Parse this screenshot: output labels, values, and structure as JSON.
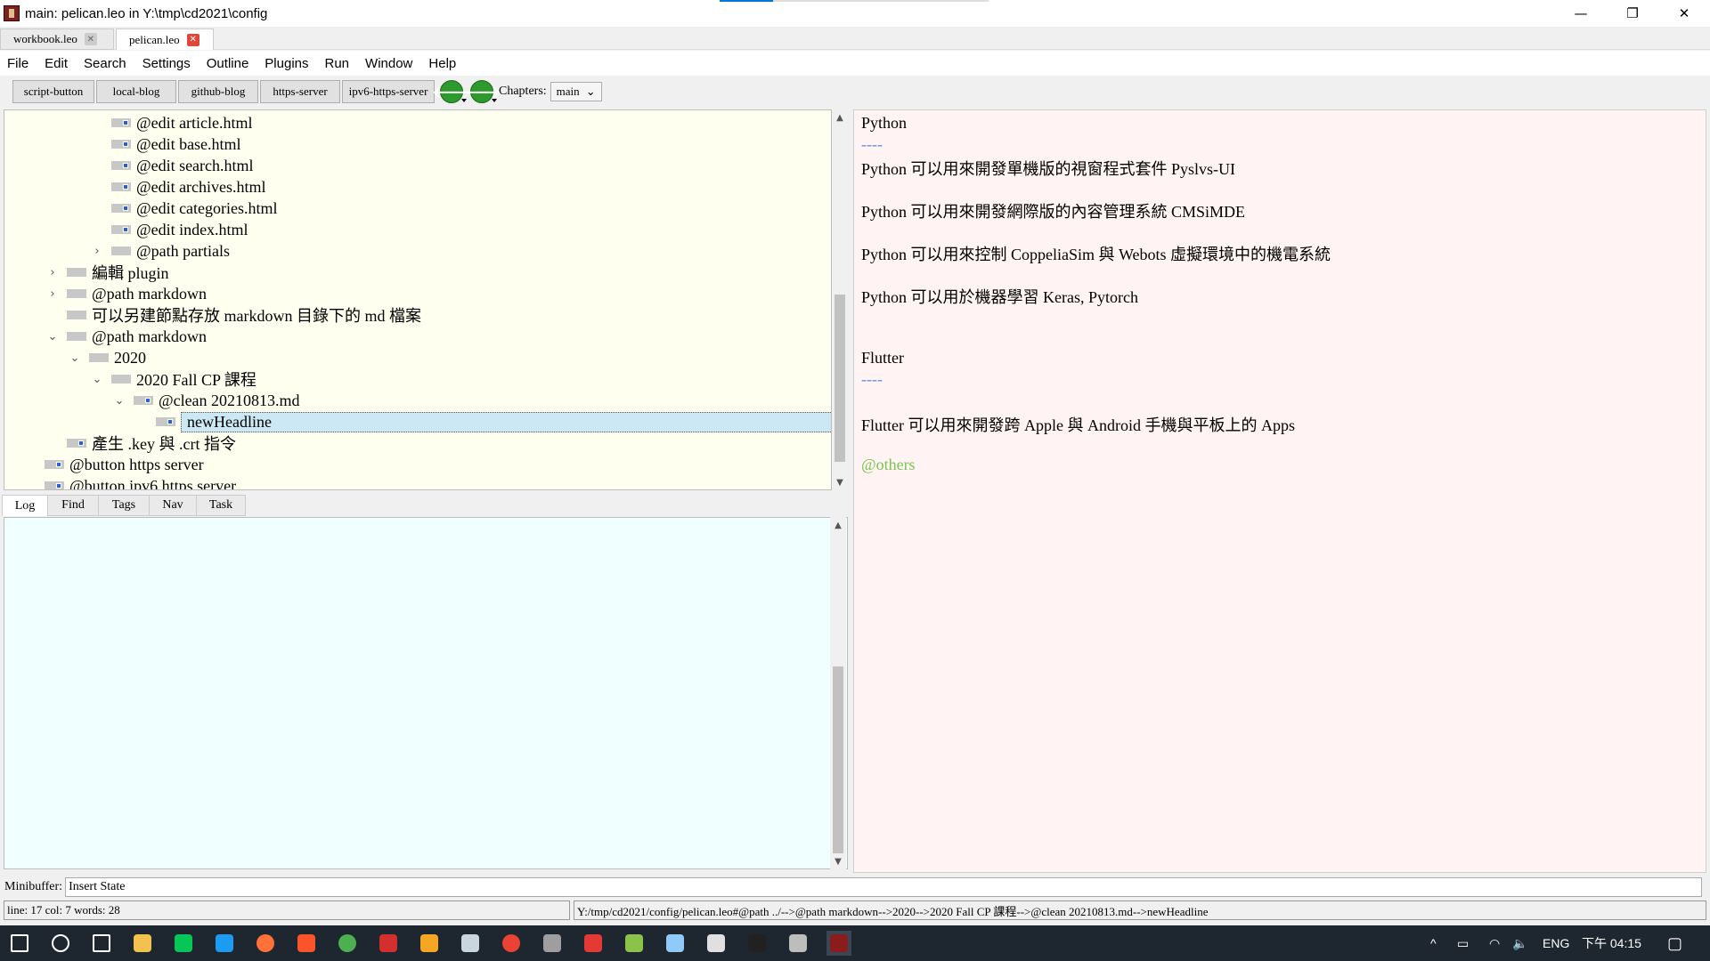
{
  "window": {
    "title": "main: pelican.leo in Y:\\tmp\\cd2021\\config",
    "controls": {
      "minimize": "—",
      "maximize": "❐",
      "close": "✕"
    },
    "progress_fraction": 0.2
  },
  "file_tabs": [
    {
      "label": "workbook.leo",
      "active": false
    },
    {
      "label": "pelican.leo",
      "active": true
    }
  ],
  "menu": [
    "File",
    "Edit",
    "Search",
    "Settings",
    "Outline",
    "Plugins",
    "Run",
    "Window",
    "Help"
  ],
  "toolbar": {
    "buttons": [
      "script-button",
      "local-blog",
      "github-blog",
      "https-server",
      "ipv6-https-server"
    ],
    "back_glyph": "🡐",
    "forward_glyph": "🡒",
    "chapters_label": "Chapters:",
    "chapters_value": "main"
  },
  "outline": {
    "rows": [
      {
        "text": "@edit article.html",
        "level": 4,
        "chevron": "",
        "icon": "dirty"
      },
      {
        "text": "@edit base.html",
        "level": 4,
        "chevron": "",
        "icon": "dirty"
      },
      {
        "text": "@edit search.html",
        "level": 4,
        "chevron": "",
        "icon": "dirty"
      },
      {
        "text": "@edit archives.html",
        "level": 4,
        "chevron": "",
        "icon": "dirty"
      },
      {
        "text": "@edit categories.html",
        "level": 4,
        "chevron": "",
        "icon": "dirty"
      },
      {
        "text": "@edit index.html",
        "level": 4,
        "chevron": "",
        "icon": "dirty"
      },
      {
        "text": "@path partials",
        "level": 4,
        "chevron": "›",
        "icon": "plain"
      },
      {
        "text": "編輯 plugin",
        "level": 2,
        "chevron": "›",
        "icon": "plain"
      },
      {
        "text": "@path markdown",
        "level": 2,
        "chevron": "›",
        "icon": "plain"
      },
      {
        "text": "可以另建節點存放 markdown 目錄下的 md 檔案",
        "level": 2,
        "chevron": "",
        "icon": "plain"
      },
      {
        "text": "@path markdown",
        "level": 2,
        "chevron": "⌄",
        "icon": "plain"
      },
      {
        "text": "2020",
        "level": 3,
        "chevron": "⌄",
        "icon": "plain"
      },
      {
        "text": "2020 Fall CP 課程",
        "level": 4,
        "chevron": "⌄",
        "icon": "plain"
      },
      {
        "text": "@clean 20210813.md",
        "level": 5,
        "chevron": "⌄",
        "icon": "dirty"
      },
      {
        "text": "newHeadline",
        "level": 6,
        "chevron": "",
        "icon": "dirty",
        "selected": true
      },
      {
        "text": "產生 .key 與 .crt 指令",
        "level": 2,
        "chevron": "",
        "icon": "dirty"
      },
      {
        "text": "@button https server",
        "level": 1,
        "chevron": "",
        "icon": "dirty"
      },
      {
        "text": "@button ipv6 https server",
        "level": 1,
        "chevron": "",
        "icon": "dirty"
      }
    ]
  },
  "bottom_tabs": [
    "Log",
    "Find",
    "Tags",
    "Nav",
    "Task"
  ],
  "body_lines": [
    {
      "text": "Python",
      "style": "normal"
    },
    {
      "text": "----",
      "style": "dash"
    },
    {
      "text": "Python 可以用來開發單機版的視窗程式套件 Pyslvs-UI",
      "style": "normal"
    },
    {
      "text": "",
      "style": "normal"
    },
    {
      "text": "Python 可以用來開發網際版的內容管理系統 CMSiMDE",
      "style": "normal"
    },
    {
      "text": "",
      "style": "normal"
    },
    {
      "text": "Python 可以用來控制 CoppeliaSim 與 Webots 虛擬環境中的機電系統",
      "style": "normal"
    },
    {
      "text": "",
      "style": "normal"
    },
    {
      "text": "Python 可以用於機器學習 Keras, Pytorch",
      "style": "normal"
    },
    {
      "text": "",
      "style": "normal"
    },
    {
      "text": "",
      "style": "normal"
    },
    {
      "text": "Flutter",
      "style": "normal"
    },
    {
      "text": "----",
      "style": "dash"
    },
    {
      "text": "",
      "style": "normal"
    },
    {
      "text": "Flutter 可以用來開發跨 Apple 與 Android 手機與平板上的 Apps",
      "style": "normal"
    },
    {
      "text": "",
      "style": "normal"
    },
    {
      "text": "@others",
      "style": "others"
    }
  ],
  "minibuffer": {
    "label": "Minibuffer:",
    "value": "Insert State"
  },
  "status": {
    "left": "line: 17 col: 7  words: 28",
    "right": "Y:/tmp/cd2021/config/pelican.leo#@path ../-->@path markdown-->2020-->2020 Fall CP 課程-->@clean 20210813.md-->newHeadline"
  },
  "taskbar": {
    "icons": [
      "windows-start-icon",
      "search-icon",
      "task-view-icon",
      "file-explorer-icon",
      "line-app-icon",
      "edge-icon",
      "firefox-icon",
      "brave-icon",
      "chrome-icon",
      "acrobat-icon",
      "ink-app-icon",
      "folder-app-icon",
      "chromium-icon",
      "obs-icon",
      "red-app-icon",
      "node-icon",
      "blue-app-icon",
      "notepad-icon",
      "terminal-icon",
      "settings-app-icon",
      "leo-app-icon"
    ],
    "icon_colors": [
      "#ffffff",
      "#ffffff",
      "#ffffff",
      "#f2c14e",
      "#06c755",
      "#1d9bf0",
      "#ff7139",
      "#fb542b",
      "#4caf50",
      "#d32f2f",
      "#f5a623",
      "#c9d6e0",
      "#ea4335",
      "#9e9e9e",
      "#e53935",
      "#8bc34a",
      "#90caf9",
      "#e0e0e0",
      "#212121",
      "#bdbdbd",
      "#8a1c1c"
    ],
    "tray": {
      "chevron": "^",
      "lang": "ENG",
      "time": "下午 04:15"
    }
  }
}
